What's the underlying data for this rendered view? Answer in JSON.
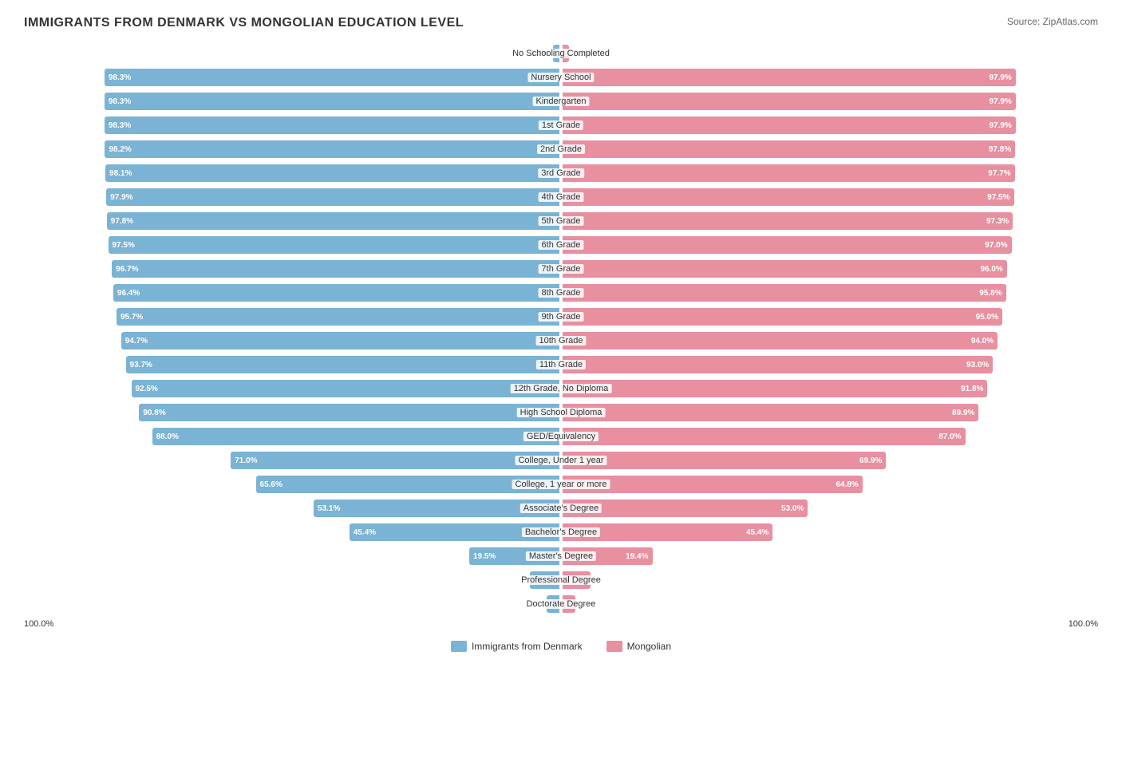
{
  "title": "IMMIGRANTS FROM DENMARK VS MONGOLIAN EDUCATION LEVEL",
  "source": "Source: ZipAtlas.com",
  "colors": {
    "denmark": "#7ab3d4",
    "mongolian": "#e88fa0"
  },
  "legend": {
    "denmark_label": "Immigrants from Denmark",
    "mongolian_label": "Mongolian"
  },
  "x_axis": {
    "left": "100.0%",
    "right": "100.0%"
  },
  "rows": [
    {
      "label": "No Schooling Completed",
      "left_pct": 1.7,
      "right_pct": 2.1,
      "left_val": "1.7%",
      "right_val": "2.1%",
      "small": true
    },
    {
      "label": "Nursery School",
      "left_pct": 98.3,
      "right_pct": 97.9,
      "left_val": "98.3%",
      "right_val": "97.9%"
    },
    {
      "label": "Kindergarten",
      "left_pct": 98.3,
      "right_pct": 97.9,
      "left_val": "98.3%",
      "right_val": "97.9%"
    },
    {
      "label": "1st Grade",
      "left_pct": 98.3,
      "right_pct": 97.9,
      "left_val": "98.3%",
      "right_val": "97.9%"
    },
    {
      "label": "2nd Grade",
      "left_pct": 98.2,
      "right_pct": 97.8,
      "left_val": "98.2%",
      "right_val": "97.8%"
    },
    {
      "label": "3rd Grade",
      "left_pct": 98.1,
      "right_pct": 97.7,
      "left_val": "98.1%",
      "right_val": "97.7%"
    },
    {
      "label": "4th Grade",
      "left_pct": 97.9,
      "right_pct": 97.5,
      "left_val": "97.9%",
      "right_val": "97.5%"
    },
    {
      "label": "5th Grade",
      "left_pct": 97.8,
      "right_pct": 97.3,
      "left_val": "97.8%",
      "right_val": "97.3%"
    },
    {
      "label": "6th Grade",
      "left_pct": 97.5,
      "right_pct": 97.0,
      "left_val": "97.5%",
      "right_val": "97.0%"
    },
    {
      "label": "7th Grade",
      "left_pct": 96.7,
      "right_pct": 96.0,
      "left_val": "96.7%",
      "right_val": "96.0%"
    },
    {
      "label": "8th Grade",
      "left_pct": 96.4,
      "right_pct": 95.8,
      "left_val": "96.4%",
      "right_val": "95.8%"
    },
    {
      "label": "9th Grade",
      "left_pct": 95.7,
      "right_pct": 95.0,
      "left_val": "95.7%",
      "right_val": "95.0%"
    },
    {
      "label": "10th Grade",
      "left_pct": 94.7,
      "right_pct": 94.0,
      "left_val": "94.7%",
      "right_val": "94.0%"
    },
    {
      "label": "11th Grade",
      "left_pct": 93.7,
      "right_pct": 93.0,
      "left_val": "93.7%",
      "right_val": "93.0%"
    },
    {
      "label": "12th Grade, No Diploma",
      "left_pct": 92.5,
      "right_pct": 91.8,
      "left_val": "92.5%",
      "right_val": "91.8%"
    },
    {
      "label": "High School Diploma",
      "left_pct": 90.8,
      "right_pct": 89.9,
      "left_val": "90.8%",
      "right_val": "89.9%"
    },
    {
      "label": "GED/Equivalency",
      "left_pct": 88.0,
      "right_pct": 87.0,
      "left_val": "88.0%",
      "right_val": "87.0%"
    },
    {
      "label": "College, Under 1 year",
      "left_pct": 71.0,
      "right_pct": 69.9,
      "left_val": "71.0%",
      "right_val": "69.9%"
    },
    {
      "label": "College, 1 year or more",
      "left_pct": 65.6,
      "right_pct": 64.8,
      "left_val": "65.6%",
      "right_val": "64.8%"
    },
    {
      "label": "Associate's Degree",
      "left_pct": 53.1,
      "right_pct": 53.0,
      "left_val": "53.1%",
      "right_val": "53.0%"
    },
    {
      "label": "Bachelor's Degree",
      "left_pct": 45.4,
      "right_pct": 45.4,
      "left_val": "45.4%",
      "right_val": "45.4%"
    },
    {
      "label": "Master's Degree",
      "left_pct": 19.5,
      "right_pct": 19.4,
      "left_val": "19.5%",
      "right_val": "19.4%"
    },
    {
      "label": "Professional Degree",
      "left_pct": 6.4,
      "right_pct": 6.1,
      "left_val": "6.4%",
      "right_val": "6.1%"
    },
    {
      "label": "Doctorate Degree",
      "left_pct": 2.8,
      "right_pct": 2.8,
      "left_val": "2.8%",
      "right_val": "2.8%"
    }
  ]
}
